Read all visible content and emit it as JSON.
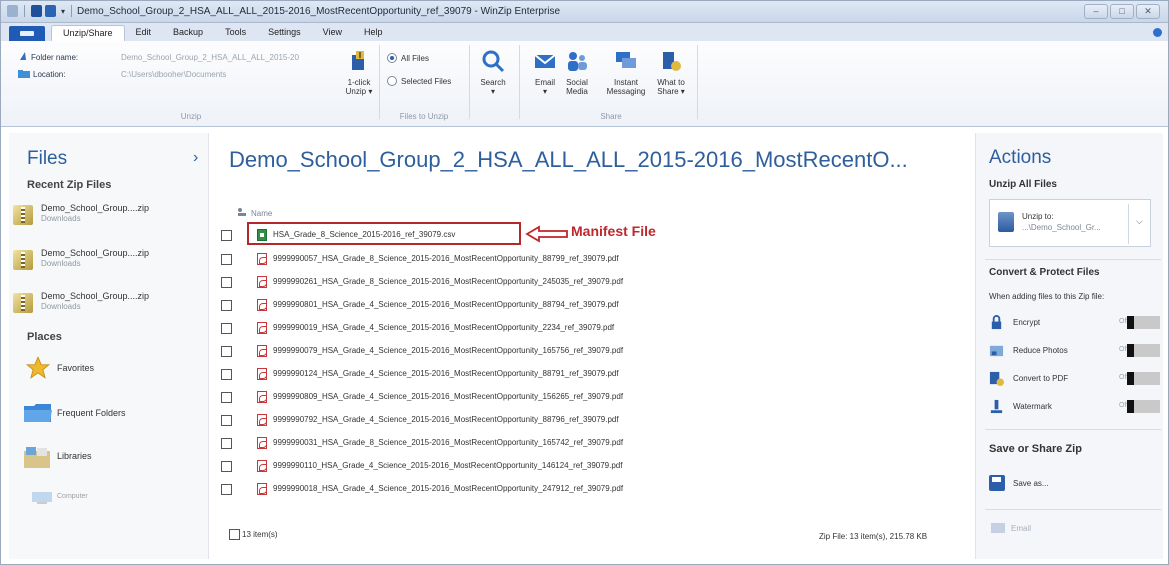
{
  "window": {
    "title": "Demo_School_Group_2_HSA_ALL_ALL_2015-2016_MostRecentOpportunity_ref_39079 - WinZip Enterprise",
    "quick_access_arrow": "▾",
    "buttons": {
      "minimize": "–",
      "maximize": "□",
      "close": "✕"
    }
  },
  "ribbon": {
    "tabs": [
      "Unzip/Share",
      "Edit",
      "Backup",
      "Tools",
      "Settings",
      "View",
      "Help"
    ],
    "unzip": {
      "folder_label": "Folder name:",
      "folder_value": "Demo_School_Group_2_HSA_ALL_ALL_2015-20",
      "location_label": "Location:",
      "location_value": "C:\\Users\\dbooher\\Documents",
      "one_click_line1": "1-click",
      "one_click_line2": "Unzip ▾",
      "group_label": "Unzip"
    },
    "files_to_unzip": {
      "all_files": "All Files",
      "selected_files": "Selected Files",
      "group_label": "Files to Unzip"
    },
    "search": {
      "label": "Search",
      "arrow": "▾"
    },
    "share": {
      "email": "Email",
      "email_arrow": "▾",
      "social_line1": "Social",
      "social_line2": "Media",
      "instant_line1": "Instant",
      "instant_line2": "Messaging",
      "whatto_line1": "What to",
      "whatto_line2": "Share ▾",
      "group_label": "Share"
    }
  },
  "files_pane": {
    "title": "Files",
    "chevron": "›",
    "recent_heading": "Recent Zip Files",
    "recent": [
      {
        "name": "Demo_School_Group....zip",
        "location": "Downloads"
      },
      {
        "name": "Demo_School_Group....zip",
        "location": "Downloads"
      },
      {
        "name": "Demo_School_Group....zip",
        "location": "Downloads"
      }
    ],
    "places_heading": "Places",
    "places": [
      "Favorites",
      "Frequent Folders",
      "Libraries",
      "Computer"
    ]
  },
  "main": {
    "title": "Demo_School_Group_2_HSA_ALL_ALL_2015-2016_MostRecentO...",
    "column_name": "Name",
    "annotation": "Manifest File",
    "files": [
      {
        "name": "HSA_Grade_8_Science_2015-2016_ref_39079.csv",
        "type": "csv"
      },
      {
        "name": "9999990057_HSA_Grade_8_Science_2015-2016_MostRecentOpportunity_88799_ref_39079.pdf",
        "type": "pdf"
      },
      {
        "name": "9999990261_HSA_Grade_8_Science_2015-2016_MostRecentOpportunity_245035_ref_39079.pdf",
        "type": "pdf"
      },
      {
        "name": "9999990801_HSA_Grade_4_Science_2015-2016_MostRecentOpportunity_88794_ref_39079.pdf",
        "type": "pdf"
      },
      {
        "name": "9999990019_HSA_Grade_4_Science_2015-2016_MostRecentOpportunity_2234_ref_39079.pdf",
        "type": "pdf"
      },
      {
        "name": "9999990079_HSA_Grade_4_Science_2015-2016_MostRecentOpportunity_165756_ref_39079.pdf",
        "type": "pdf"
      },
      {
        "name": "9999990124_HSA_Grade_4_Science_2015-2016_MostRecentOpportunity_88791_ref_39079.pdf",
        "type": "pdf"
      },
      {
        "name": "9999990809_HSA_Grade_4_Science_2015-2016_MostRecentOpportunity_156265_ref_39079.pdf",
        "type": "pdf"
      },
      {
        "name": "9999990792_HSA_Grade_4_Science_2015-2016_MostRecentOpportunity_88796_ref_39079.pdf",
        "type": "pdf"
      },
      {
        "name": "9999990031_HSA_Grade_8_Science_2015-2016_MostRecentOpportunity_165742_ref_39079.pdf",
        "type": "pdf"
      },
      {
        "name": "9999990110_HSA_Grade_4_Science_2015-2016_MostRecentOpportunity_146124_ref_39079.pdf",
        "type": "pdf"
      },
      {
        "name": "9999990018_HSA_Grade_4_Science_2015-2016_MostRecentOpportunity_247912_ref_39079.pdf",
        "type": "pdf"
      }
    ],
    "status_items": "13 item(s)",
    "status_zip": "Zip File: 13 item(s), 215.78 KB"
  },
  "actions_pane": {
    "title": "Actions",
    "unzip_heading": "Unzip All Files",
    "unzip_to_label": "Unzip to:",
    "unzip_to_path": "...\\Demo_School_Gr...",
    "unzip_chevron": "⌵",
    "convert_heading": "Convert & Protect Files",
    "convert_sub": "When adding files to this Zip file:",
    "options": [
      {
        "label": "Encrypt",
        "state": "Off"
      },
      {
        "label": "Reduce Photos",
        "state": "Off"
      },
      {
        "label": "Convert to PDF",
        "state": "Off"
      },
      {
        "label": "Watermark",
        "state": "Off"
      }
    ],
    "save_heading": "Save or Share Zip",
    "save_as": "Save as...",
    "email": "Email"
  },
  "colors": {
    "accent": "#2e5f9c",
    "annotation": "#c0262d"
  }
}
